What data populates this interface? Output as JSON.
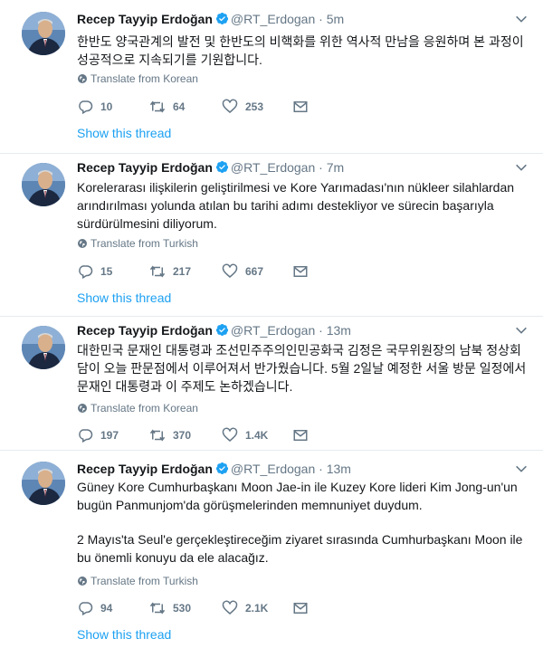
{
  "tweets": [
    {
      "author_name": "Recep Tayyip Erdoğan",
      "handle": "@RT_Erdogan",
      "separator": "·",
      "time": "5m",
      "body": "한반도 양국관계의 발전 및 한반도의 비핵화를 위한 역사적 만남을 응원하며 본 과정이 성공적으로 지속되기를 기원합니다.",
      "translate_label": "Translate from Korean",
      "replies": "10",
      "retweets": "64",
      "likes": "253",
      "show_thread": "Show this thread"
    },
    {
      "author_name": "Recep Tayyip Erdoğan",
      "handle": "@RT_Erdogan",
      "separator": "·",
      "time": "7m",
      "body": "Korelerarası ilişkilerin geliştirilmesi ve Kore Yarımadası'nın nükleer silahlardan arındırılması yolunda atılan bu tarihi adımı destekliyor ve sürecin başarıyla sürdürülmesini diliyorum.",
      "translate_label": "Translate from Turkish",
      "replies": "15",
      "retweets": "217",
      "likes": "667",
      "show_thread": "Show this thread"
    },
    {
      "author_name": "Recep Tayyip Erdoğan",
      "handle": "@RT_Erdogan",
      "separator": "·",
      "time": "13m",
      "body": "대한민국 문재인 대통령과 조선민주주의인민공화국 김정은 국무위원장의 남북 정상회담이 오늘 판문점에서 이루어져서 반가웠습니다. 5월 2일날 예정한 서울 방문 일정에서 문재인 대통령과 이 주제도 논하겠습니다.",
      "translate_label": "Translate from Korean",
      "replies": "197",
      "retweets": "370",
      "likes": "1.4K"
    },
    {
      "author_name": "Recep Tayyip Erdoğan",
      "handle": "@RT_Erdogan",
      "separator": "·",
      "time": "13m",
      "body": "Güney Kore Cumhurbaşkanı Moon Jae-in ile Kuzey Kore lideri Kim Jong-un'un bugün Panmunjom'da görüşmelerinden memnuniyet duydum.",
      "body2": "2 Mayıs'ta Seul'e gerçekleştireceğim ziyaret sırasında Cumhurbaşkanı Moon ile bu önemli konuyu da ele alacağız.",
      "translate_label": "Translate from Turkish",
      "replies": "94",
      "retweets": "530",
      "likes": "2.1K",
      "show_thread": "Show this thread"
    }
  ],
  "icons": {
    "verified": "verified-badge-icon",
    "caret": "chevron-down-icon",
    "globe": "globe-icon",
    "reply": "reply-icon",
    "retweet": "retweet-icon",
    "like": "heart-icon",
    "dm": "envelope-icon"
  },
  "colors": {
    "link": "#1da1f2",
    "secondary_text": "#657786",
    "primary_text": "#14171a",
    "divider": "#e6ecf0"
  }
}
